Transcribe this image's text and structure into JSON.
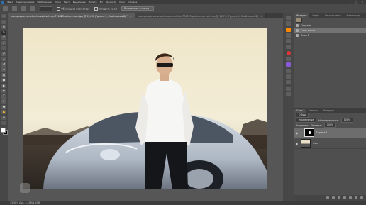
{
  "menubar": {
    "items": [
      "Файл",
      "Редактирование",
      "Изображение",
      "Слои",
      "Текст",
      "Выделение",
      "Фильтр",
      "3D",
      "Просмотр",
      "Окно",
      "Справка"
    ],
    "window_controls": [
      "–",
      "□",
      "×"
    ]
  },
  "options": {
    "select_all_layers": "Образец со всех слоев",
    "smooth": "Сгладить край",
    "select_mask": "Выделение и маска..."
  },
  "tabs": [
    {
      "label": "man-people-car-wheel-model-vehicle-774823-pxhere.com.jpg @ 33,6% (Группа 1, Слой-маска/8) *",
      "active": true
    },
    {
      "label": "man-people-car-wheel-model-vehicle-774823-pxhere.com-ochnoe @ 16,7% (Группа 1, Слой-маска/8)",
      "active": false
    }
  ],
  "history": {
    "tabs": [
      "История",
      "Инфо",
      "Гистограмма",
      "Навигатор"
    ],
    "items": [
      {
        "label": "...",
        "kind": "snapshot"
      },
      {
        "label": "Открыть",
        "kind": "step"
      },
      {
        "label": "Слой-маска",
        "kind": "step"
      },
      {
        "label": "Слой 1",
        "kind": "step"
      }
    ]
  },
  "layers": {
    "tabs": [
      "Слои",
      "Каналы",
      "Контуры"
    ],
    "filter_label": "Q Вид",
    "blend_mode": "Нормальные",
    "opacity_label": "Непрозрачность:",
    "opacity_value": "100%",
    "lock_label": "Закрепить:",
    "fill_label": "Заливка:",
    "fill_value": "100%",
    "items": [
      {
        "name": "Группа 1",
        "selected": true,
        "has_mask": true
      },
      {
        "name": "Фон",
        "selected": false,
        "has_mask": false
      }
    ]
  },
  "status": {
    "text": "33,58%   Док: 4,45М/4,45М"
  },
  "colors": {
    "foreground": "#ffffff",
    "background": "#000000"
  }
}
